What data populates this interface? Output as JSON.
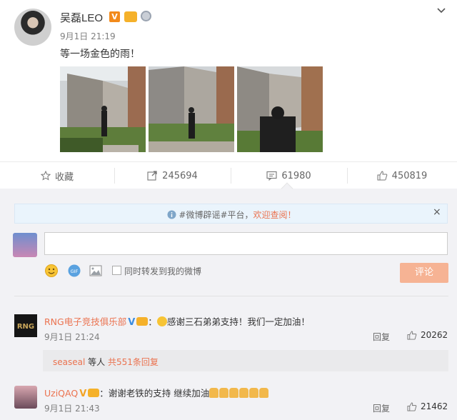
{
  "post": {
    "username": "吴磊LEO",
    "verified_badge": "V",
    "timestamp": "9月1日 21:19",
    "text": "等一场金色的雨！",
    "photos": [
      "photo-1",
      "photo-2",
      "photo-3"
    ]
  },
  "actions": {
    "favorite": "收藏",
    "repost_count": "245694",
    "comment_count": "61980",
    "like_count": "450819"
  },
  "notice": {
    "prefix": "#微博辟谣#平台，",
    "link": "欢迎查阅！",
    "close": "×"
  },
  "composer": {
    "input_value": "",
    "repost_label": "同时转发到我的微博",
    "submit": "评论"
  },
  "comments": [
    {
      "user": "RNG电子竞技俱乐部",
      "colon": "：",
      "text": "感谢三石弟弟支持！我们一定加油！",
      "time": "9月1日 21:24",
      "reply": "回复",
      "likes": "20262",
      "sub": {
        "user": "seaseal",
        "middle": " 等人 ",
        "link": "共551条回复"
      }
    },
    {
      "user": "UziQAQ",
      "colon": "：",
      "text": "谢谢老铁的支持 继续加油",
      "time": "9月1日 21:43",
      "reply": "回复",
      "likes": "21462"
    }
  ],
  "colors": {
    "accent": "#eb7350",
    "vip_orange": "#f28a1c",
    "verified_blue": "#3d8ddf"
  },
  "icons": [
    "chevron-down-icon",
    "star-icon",
    "repost-icon",
    "comment-icon",
    "thumbs-up-icon",
    "info-icon",
    "emoji-icon",
    "gif-icon",
    "image-icon"
  ]
}
